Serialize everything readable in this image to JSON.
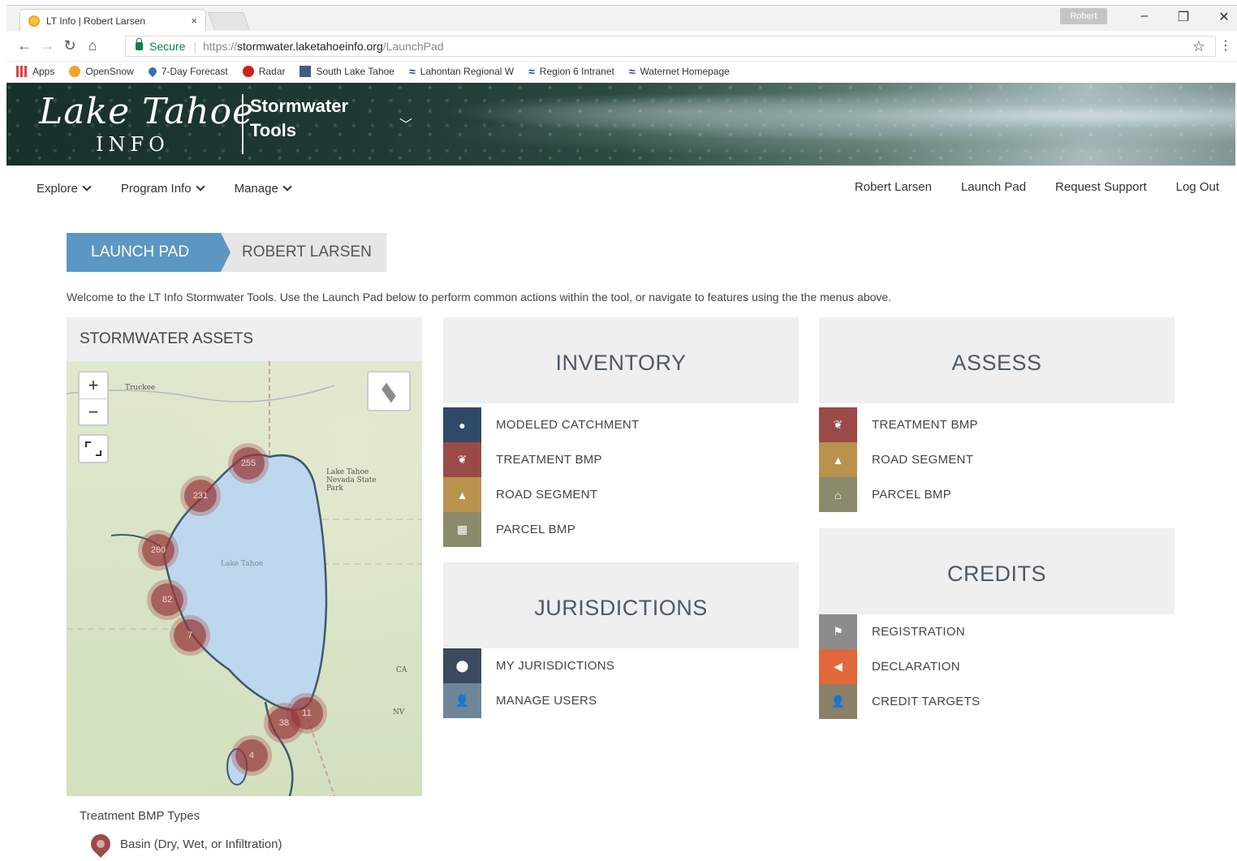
{
  "browser": {
    "tab_title": "LT Info | Robert Larsen",
    "tab_close": "×",
    "user_badge": "Robert",
    "url_secure": "Secure",
    "url_protocol": "https://",
    "url_host": "stormwater.laketahoeinfo.org",
    "url_path": "/LaunchPad",
    "bookmarks": [
      {
        "label": "Apps",
        "icon": "apps-grid-icon"
      },
      {
        "label": "OpenSnow",
        "icon": "sun-icon"
      },
      {
        "label": "7-Day Forecast",
        "icon": "weather-icon"
      },
      {
        "label": "Radar",
        "icon": "radar-icon"
      },
      {
        "label": "South Lake Tahoe",
        "icon": "city-icon"
      },
      {
        "label": "Lahontan Regional W",
        "icon": "wave-icon"
      },
      {
        "label": "Region 6 Intranet",
        "icon": "wave-icon"
      },
      {
        "label": "Waternet Homepage",
        "icon": "wave-icon"
      }
    ]
  },
  "banner": {
    "logo_script": "Lake Tahoe",
    "logo_info": "INFO",
    "app_title_line1": "Stormwater",
    "app_title_line2": "Tools"
  },
  "nav": {
    "left": [
      {
        "label": "Explore"
      },
      {
        "label": "Program Info"
      },
      {
        "label": "Manage"
      }
    ],
    "right": [
      {
        "label": "Robert Larsen"
      },
      {
        "label": "Launch Pad"
      },
      {
        "label": "Request Support"
      },
      {
        "label": "Log Out"
      }
    ]
  },
  "breadcrumb": {
    "active": "LAUNCH PAD",
    "next": "ROBERT LARSEN"
  },
  "welcome": "Welcome to the LT Info Stormwater Tools. Use the Launch Pad below to perform common actions within the tool, or navigate to features using the the menus above.",
  "map": {
    "title": "STORMWATER ASSETS",
    "zoom_in": "+",
    "zoom_out": "−",
    "lake_label": "Lake Tahoe",
    "towns": [
      "Truckee",
      "Lake Tahoe Nevada State Park",
      "CA",
      "NV"
    ],
    "clusters": [
      "255",
      "231",
      "260",
      "82",
      "7",
      "11",
      "38",
      "4"
    ],
    "legend_title": "Treatment BMP Types",
    "legend_items": [
      "Basin (Dry, Wet, or Infiltration)"
    ]
  },
  "inventory": {
    "title": "INVENTORY",
    "items": [
      "MODELED CATCHMENT",
      "TREATMENT BMP",
      "ROAD SEGMENT",
      "PARCEL BMP"
    ]
  },
  "jurisdictions": {
    "title": "JURISDICTIONS",
    "items": [
      "MY JURISDICTIONS",
      "MANAGE USERS"
    ]
  },
  "assess": {
    "title": "ASSESS",
    "items": [
      "TREATMENT BMP",
      "ROAD SEGMENT",
      "PARCEL BMP"
    ]
  },
  "credits": {
    "title": "CREDITS",
    "items": [
      "REGISTRATION",
      "DECLARATION",
      "CREDIT TARGETS"
    ]
  }
}
